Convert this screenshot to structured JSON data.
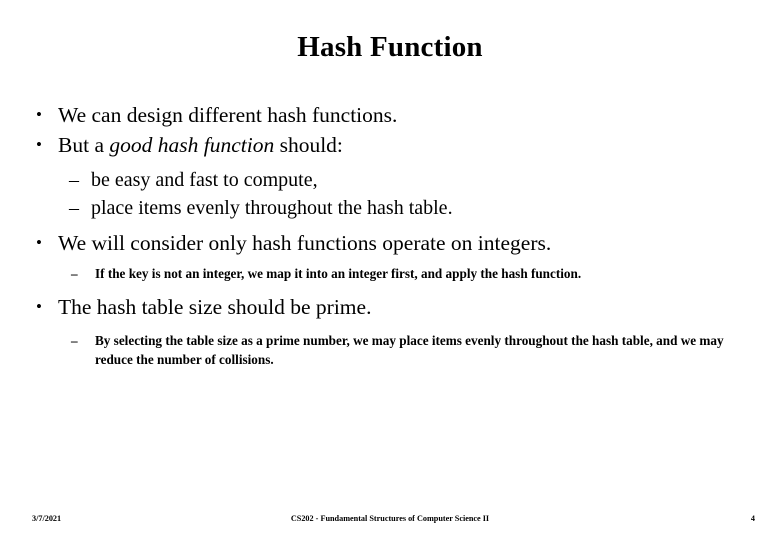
{
  "slide": {
    "title": "Hash Function",
    "page_background": "#ffffff",
    "text_color": "#000000"
  },
  "content": {
    "bullets": [
      {
        "level": 1,
        "marker": "•",
        "text": "We can design different hash functions."
      },
      {
        "level": 1,
        "marker": "•",
        "text_before_italic": "But a ",
        "text_italic": "good hash function",
        "text_after_italic": " should:"
      },
      {
        "level": 2,
        "marker": "–",
        "text": "be easy and fast to compute,"
      },
      {
        "level": 2,
        "marker": "–",
        "text": "place items evenly throughout the hash table."
      },
      {
        "level": 1,
        "marker": "•",
        "text": "We will consider only hash functions operate on integers."
      },
      {
        "level": 3,
        "marker": "–",
        "text": "If the key is not an integer, we map it into an integer first, and apply the hash function."
      },
      {
        "level": 1,
        "marker": "•",
        "text": "The hash table size should be prime."
      },
      {
        "level": 3,
        "marker": "–",
        "text": "By selecting the table size as a prime number, we may place items evenly throughout the hash table, and we may reduce the number of collisions."
      }
    ]
  },
  "footer": {
    "date": "3/7/2021",
    "course": "CS202 - Fundamental Structures of Computer Science II",
    "page_number": "4"
  }
}
